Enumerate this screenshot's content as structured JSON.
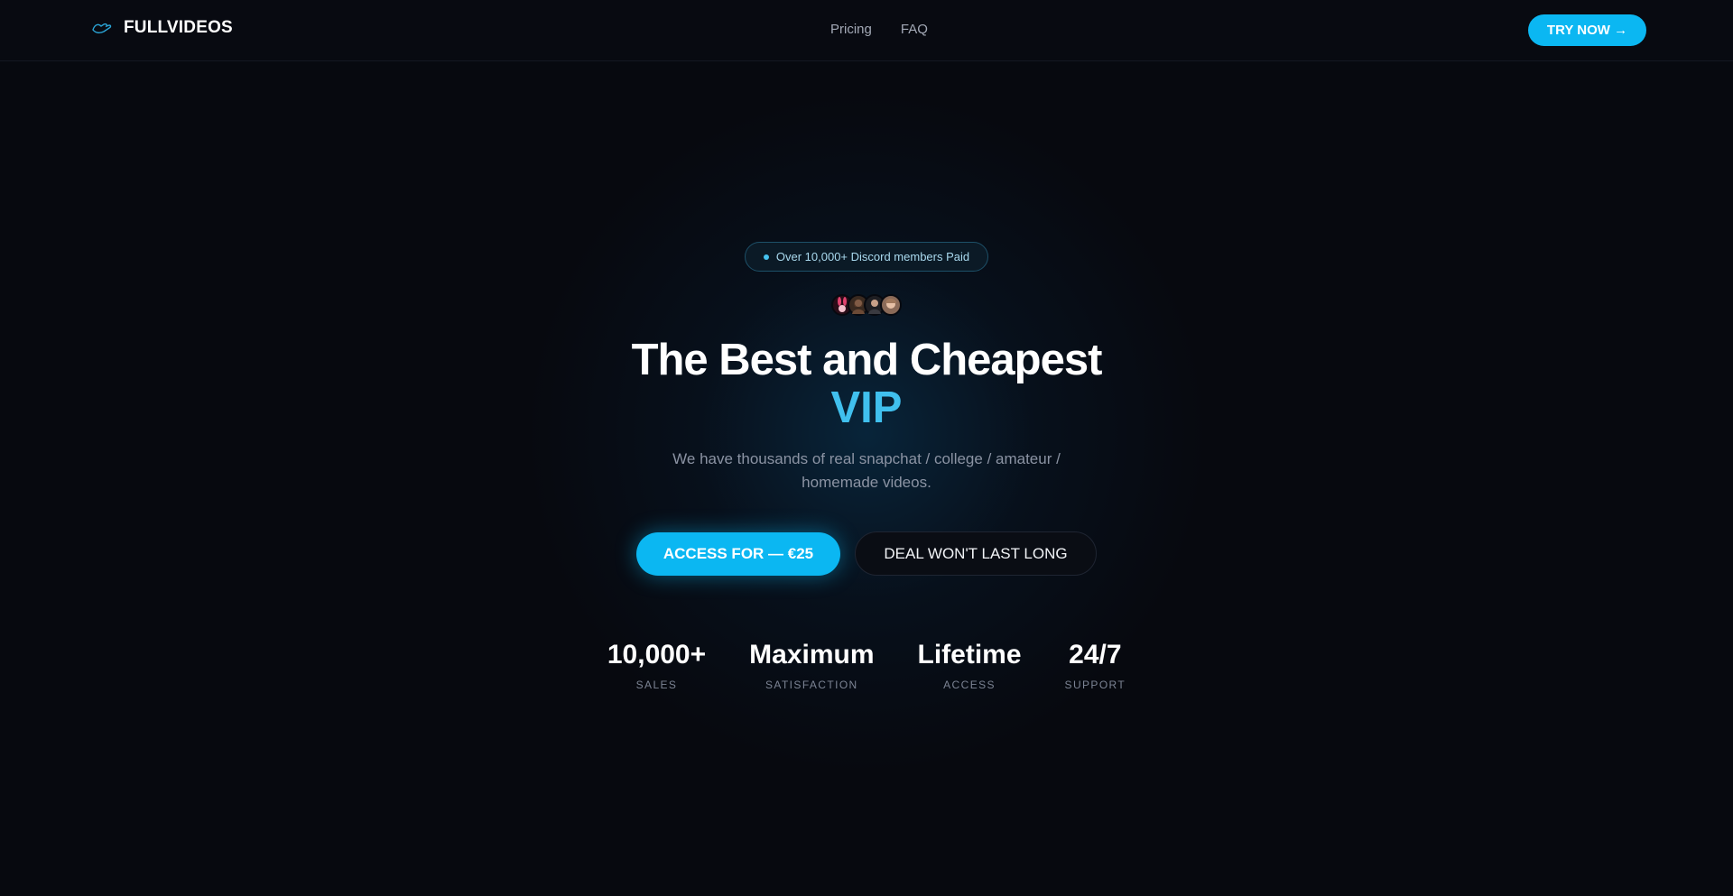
{
  "header": {
    "brand_name": "FULLVIDEOS",
    "brand_icon": "hand-wave-icon",
    "nav": [
      {
        "label": "Pricing"
      },
      {
        "label": "FAQ"
      }
    ],
    "cta_label": "TRY NOW →"
  },
  "hero": {
    "badge_text": "Over 10,000+ Discord members Paid",
    "avatars": [
      {
        "icon": "bunny-avatar",
        "color": "#c9305a"
      },
      {
        "icon": "person-avatar",
        "color": "#8a6a52"
      },
      {
        "icon": "person-avatar",
        "color": "#4a4a4a"
      },
      {
        "icon": "person-avatar",
        "color": "#b58a6e"
      }
    ],
    "headline": "The Best and Cheapest",
    "headline_accent": "VIP",
    "subtitle": "We have thousands of real snapchat / college / amateur / homemade videos.",
    "primary_cta": "ACCESS FOR — €25",
    "secondary_cta": "DEAL WON'T LAST LONG"
  },
  "stats": [
    {
      "value": "10,000+",
      "label": "SALES"
    },
    {
      "value": "Maximum",
      "label": "SATISFACTION"
    },
    {
      "value": "Lifetime",
      "label": "ACCESS"
    },
    {
      "value": "24/7",
      "label": "SUPPORT"
    }
  ],
  "colors": {
    "background": "#07090f",
    "accent": "#0bb7f2",
    "accent_text": "#40c0ee"
  }
}
